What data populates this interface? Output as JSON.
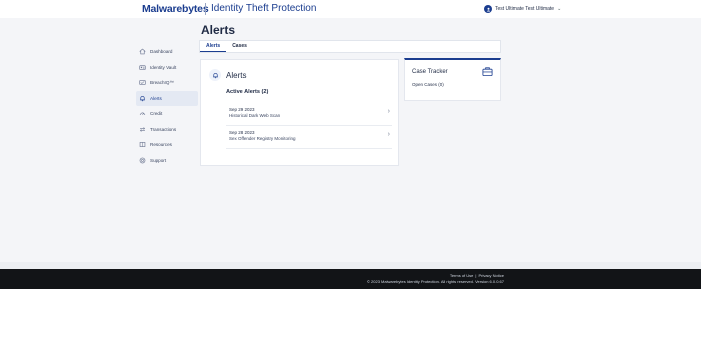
{
  "header": {
    "logo_text": "Malwarebytes",
    "product_name": "Identity Theft Protection",
    "user_name": "Test Ultimate Test Ultimate",
    "brand_color": "#1b3d8f"
  },
  "page": {
    "title": "Alerts"
  },
  "sidebar": {
    "items": [
      {
        "label": "Dashboard",
        "icon": "home-icon"
      },
      {
        "label": "Identity Vault",
        "icon": "id-card-icon"
      },
      {
        "label": "BreachIQ™",
        "icon": "breach-icon"
      },
      {
        "label": "Alerts",
        "icon": "bell-icon",
        "active": true
      },
      {
        "label": "Credit",
        "icon": "credit-icon"
      },
      {
        "label": "Transactions",
        "icon": "transactions-icon"
      },
      {
        "label": "Resources",
        "icon": "resources-icon"
      },
      {
        "label": "Support",
        "icon": "support-icon"
      }
    ]
  },
  "tabs": [
    {
      "label": "Alerts",
      "active": true
    },
    {
      "label": "Cases",
      "active": false
    }
  ],
  "alerts_card": {
    "title": "Alerts",
    "active_title": "Active Alerts (2)",
    "items": [
      {
        "date": "Sep 29 2023",
        "description": "Historical Dark Web Scan"
      },
      {
        "date": "Sep 28 2023",
        "description": "Sex Offender Registry Monitoring"
      }
    ]
  },
  "case_tracker": {
    "title": "Case Tracker",
    "open_cases": "Open Cases (0)"
  },
  "footer": {
    "terms": "Terms of Use",
    "divider": "|",
    "privacy": "Privacy Notice",
    "copyright": "© 2023 Malwarebytes Identity Protection. All rights reserved. Version 6.0.0.67"
  }
}
